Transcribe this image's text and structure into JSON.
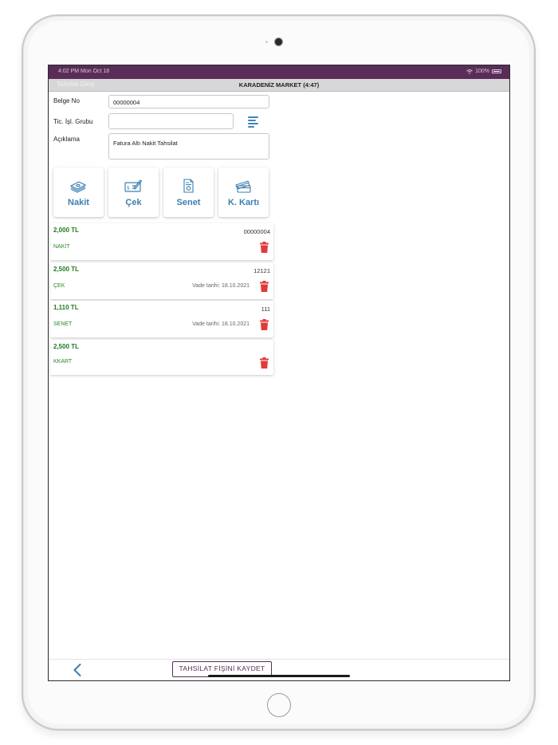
{
  "status_bar": {
    "time": "4:02 PM   Mon Oct 18",
    "battery": "100%"
  },
  "nav": {
    "left_label": "Tahsilat Girişi",
    "title": "KARADENİZ MARKET (4:47)"
  },
  "form": {
    "belge_no_label": "Belge No",
    "belge_no_value": "00000004",
    "tic_grubu_label": "Tic. İşl. Grubu",
    "tic_grubu_value": "",
    "aciklama_label": "Açıklama",
    "aciklama_value": "Fatura Altı Nakit Tahsilat"
  },
  "tiles": [
    {
      "label": "Nakit",
      "icon": "cash-icon"
    },
    {
      "label": "Çek",
      "icon": "check-icon"
    },
    {
      "label": "Senet",
      "icon": "promissory-note-icon"
    },
    {
      "label": "K. Kartı",
      "icon": "credit-card-icon"
    }
  ],
  "payments": [
    {
      "amount": "2,000 TL",
      "type": "NAKİT",
      "doc": "00000004",
      "due": ""
    },
    {
      "amount": "2,500 TL",
      "type": "ÇEK",
      "doc": "12121",
      "due": "Vade tarihi: 18.10.2021"
    },
    {
      "amount": "1,110 TL",
      "type": "SENET",
      "doc": "111",
      "due": "Vade tarihi: 18.10.2021"
    },
    {
      "amount": "2,500 TL",
      "type": "KKART",
      "doc": "",
      "due": ""
    }
  ],
  "footer": {
    "save_label": "TAHSİLAT FİŞİNİ KAYDET"
  },
  "colors": {
    "brand": "#5a2d59",
    "accent": "#3d7fb0",
    "amount_green": "#1f7a1f",
    "trash_red": "#e03a3a"
  }
}
